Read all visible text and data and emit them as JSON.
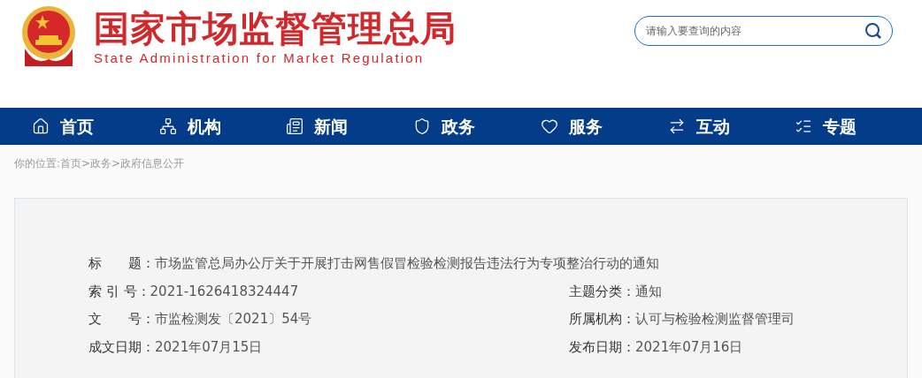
{
  "header": {
    "title": "国家市场监督管理总局",
    "subtitle": "State Administration for Market Regulation",
    "search": {
      "placeholder": "请输入要查询的内容"
    }
  },
  "nav": [
    {
      "label": "首页"
    },
    {
      "label": "机构"
    },
    {
      "label": "新闻"
    },
    {
      "label": "政务"
    },
    {
      "label": "服务"
    },
    {
      "label": "互动"
    },
    {
      "label": "专题"
    }
  ],
  "breadcrumb": "你的位置:首页>政务>政府信息公开",
  "info": {
    "title": {
      "label": "标　　题：",
      "value": "市场监管总局办公厅关于开展打击网售假冒检验检测报告违法行为专项整治行动的通知"
    },
    "rows": [
      [
        {
          "label": "索 引 号：",
          "value": "2021-1626418324447"
        },
        {
          "label": "主题分类：",
          "value": "通知"
        }
      ],
      [
        {
          "label": "文　　号：",
          "value": "市监检测发〔2021〕54号"
        },
        {
          "label": "所属机构：",
          "value": "认可与检验检测监督管理司"
        }
      ],
      [
        {
          "label": "成文日期：",
          "value": "2021年07月15日"
        },
        {
          "label": "发布日期：",
          "value": "2021年07月16日"
        }
      ]
    ]
  }
}
